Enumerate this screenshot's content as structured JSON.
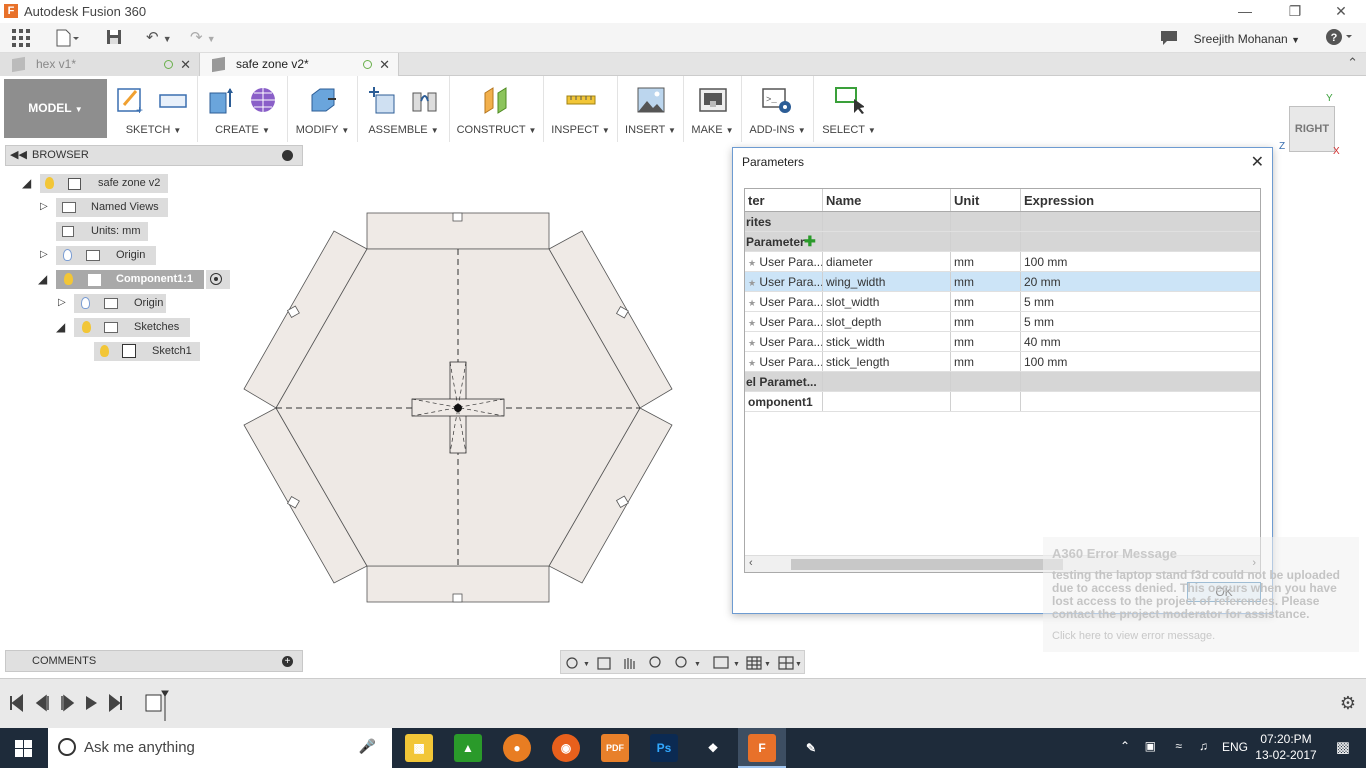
{
  "window": {
    "title": "Autodesk Fusion 360",
    "app_letter": "F"
  },
  "user": {
    "name": "Sreejith Mohanan"
  },
  "tabs": [
    {
      "label": "hex v1*"
    },
    {
      "label": "safe zone v2*"
    }
  ],
  "ribbon": {
    "workspace": "MODEL",
    "groups": [
      "SKETCH",
      "CREATE",
      "MODIFY",
      "ASSEMBLE",
      "CONSTRUCT",
      "INSPECT",
      "INSERT",
      "MAKE",
      "ADD-INS",
      "SELECT"
    ]
  },
  "browser": {
    "title": "BROWSER",
    "nodes": {
      "root": "safe zone v2",
      "named_views": "Named Views",
      "units": "Units: mm",
      "origin": "Origin",
      "component": "Component1:1",
      "comp_origin": "Origin",
      "sketches": "Sketches",
      "sketch1": "Sketch1"
    }
  },
  "comments": {
    "title": "COMMENTS"
  },
  "viewcube": {
    "face": "RIGHT",
    "axis_y": "Y",
    "axis_z": "Z",
    "axis_x": "X"
  },
  "dialog": {
    "title": "Parameters",
    "columns": [
      "ter",
      "Name",
      "Unit",
      "Expression"
    ],
    "group_favorites": "rites",
    "group_user": "Parameter",
    "rows": [
      {
        "type": "User Para...",
        "name": "diameter",
        "unit": "mm",
        "expr": "100 mm"
      },
      {
        "type": "User Para...",
        "name": "wing_width",
        "unit": "mm",
        "expr": "20 mm"
      },
      {
        "type": "User Para...",
        "name": "slot_width",
        "unit": "mm",
        "expr": "5 mm"
      },
      {
        "type": "User Para...",
        "name": "slot_depth",
        "unit": "mm",
        "expr": "5 mm"
      },
      {
        "type": "User Para...",
        "name": "stick_width",
        "unit": "mm",
        "expr": "40 mm"
      },
      {
        "type": "User Para...",
        "name": "stick_length",
        "unit": "mm",
        "expr": "100 mm"
      }
    ],
    "group_model": "el Paramet...",
    "group_component": "omponent1",
    "ok_label": "OK"
  },
  "error_note": {
    "title": "A360 Error Message",
    "body": "testing the laptop stand f3d could not be uploaded due to access denied. This occurs when you have lost access to the project of references. Please contact the project moderator for assistance.",
    "link": "Click here to view error message."
  },
  "taskbar": {
    "search_placeholder": "Ask me anything",
    "lang": "ENG",
    "time": "07:20:PM",
    "date": "13-02-2017"
  }
}
